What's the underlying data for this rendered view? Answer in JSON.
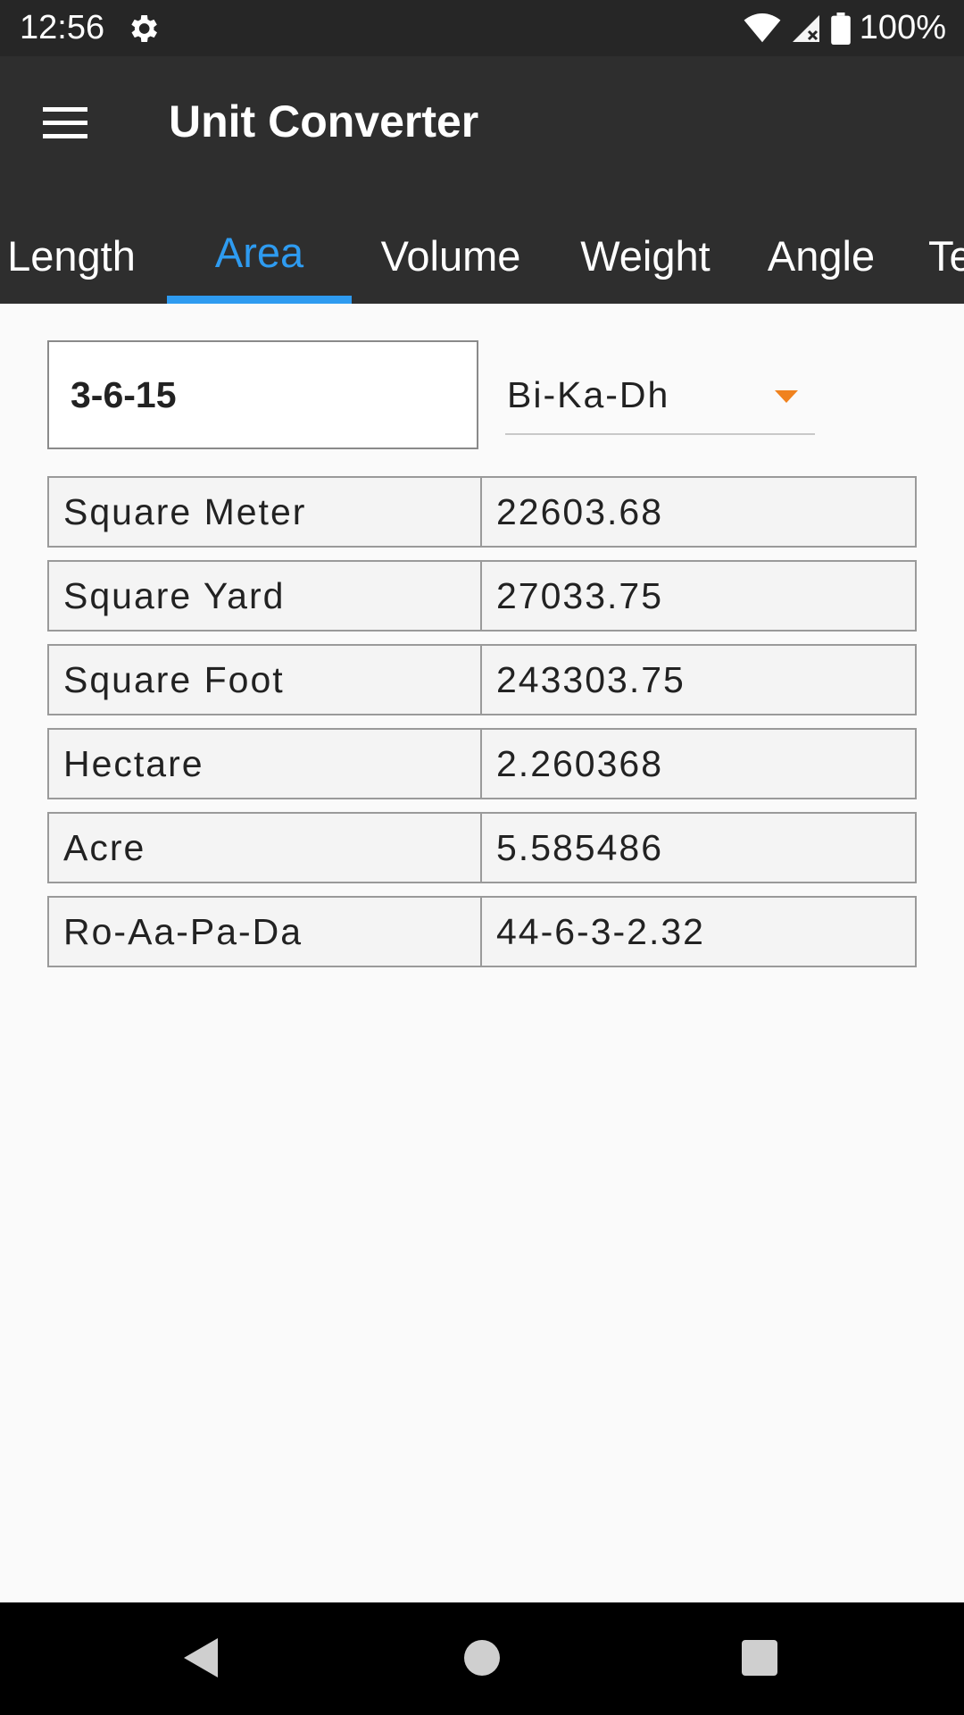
{
  "status_bar": {
    "time": "12:56",
    "battery": "100%",
    "icons": [
      "gear-icon",
      "wifi-icon",
      "signal-icon",
      "battery-icon"
    ]
  },
  "app_bar": {
    "title": "Unit Converter",
    "menu_icon": "menu-icon"
  },
  "tabs": [
    {
      "label": "Length"
    },
    {
      "label": "Area",
      "active": true
    },
    {
      "label": "Volume"
    },
    {
      "label": "Weight"
    },
    {
      "label": "Angle"
    },
    {
      "label": "Te"
    }
  ],
  "input": {
    "value": "3-6-15"
  },
  "unit_select": {
    "selected": "Bi-Ka-Dh"
  },
  "results": [
    {
      "unit": "Square Meter",
      "value": "22603.68"
    },
    {
      "unit": "Square Yard",
      "value": "27033.75"
    },
    {
      "unit": "Square Foot",
      "value": "243303.75"
    },
    {
      "unit": "Hectare",
      "value": "2.260368"
    },
    {
      "unit": "Acre",
      "value": "5.585486"
    },
    {
      "unit": "Ro-Aa-Pa-Da",
      "value": "44-6-3-2.32"
    }
  ],
  "colors": {
    "accent": "#2e9bf0",
    "dropdown_arrow": "#f0821e",
    "app_bar": "#2e2e2e"
  }
}
